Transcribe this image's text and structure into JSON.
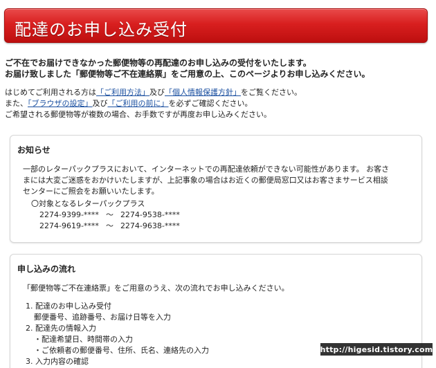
{
  "header": {
    "title": "配達のお申し込み受付"
  },
  "intro": {
    "line1": "ご不在でお届けできなかった郵便物等の再配達のお申し込みの受付をいたします。",
    "line2": "お届け致しました「郵便物等ご不在連絡票」をご用意の上、このページよりお申し込みください。"
  },
  "info": {
    "p1_prefix": "はじめてご利用される方は",
    "p1_link1": "「ご利用方法」",
    "p1_mid": "及び",
    "p1_link2": "「個人情報保護方針」",
    "p1_suffix": "をご覧ください。",
    "p2_prefix": "また、",
    "p2_link1": "「ブラウザの設定」",
    "p2_mid": "及び",
    "p2_link2": "「ご利用の前に」",
    "p2_suffix": "を必ずご確認ください。",
    "p3": "ご希望される郵便物等が複数の場合、お手数ですが再度お申し込みください。"
  },
  "notice": {
    "title": "お知らせ",
    "line1": "一部のレターパックプラスにおいて、インターネットでの再配達依頼ができない可能性があります。 お客さ",
    "line2": "まには大変ご迷惑をおかけいたしますが、上記事象の場合はお近くの郵便局窓口又はお客さまサービス相談",
    "line3": "センターにご照会をお願いいたします。",
    "targets_heading": "〇対象となるレターパックプラス",
    "ranges": [
      {
        "from": "2274-9399-****",
        "sep": "〜",
        "to": "2274-9538-****"
      },
      {
        "from": "2274-9619-****",
        "sep": "〜",
        "to": "2274-9638-****"
      }
    ]
  },
  "flow": {
    "title": "申し込みの流れ",
    "lead": "「郵便物等ご不在連絡票」をご用意のうえ、次の流れでお申し込みください。",
    "step1": "1. 配達のお申し込み受付",
    "step1_sub": "郵便番号、追跡番号、お届け日等を入力",
    "step2": "2. 配達先の情報入力",
    "step2_sub1": "・配達希望日、時間帯の入力",
    "step2_sub2": "・ご依頼者の郵便番号、住所、氏名、連絡先の入力",
    "step3": "3. 入力内容の確認"
  },
  "watermark": "http://higesid.tistory.com"
}
